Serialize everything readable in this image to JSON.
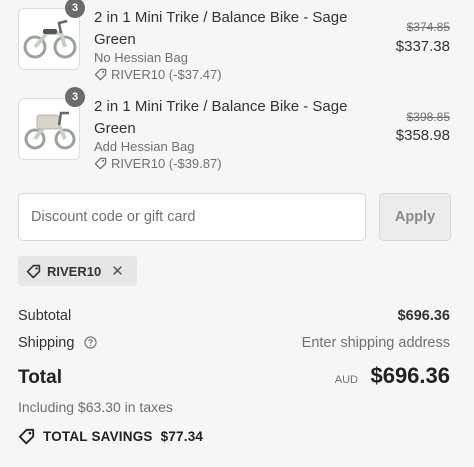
{
  "items": [
    {
      "quantity": "3",
      "name": "2 in 1 Mini Trike / Balance Bike - Sage Green",
      "variant": "No Hessian Bag",
      "discount": "RIVER10 (-$37.47)",
      "original_price": "$374.85",
      "price": "$337.38",
      "image_icon": "balance-bike-icon"
    },
    {
      "quantity": "3",
      "name": "2 in 1 Mini Trike / Balance Bike - Sage Green",
      "variant": "Add Hessian Bag",
      "discount": "RIVER10 (-$39.87)",
      "original_price": "$398.85",
      "price": "$358.98",
      "image_icon": "balance-bike-with-bag-icon"
    }
  ],
  "discount": {
    "placeholder": "Discount code or gift card",
    "apply_label": "Apply",
    "applied_code": "RIVER10"
  },
  "summary": {
    "subtotal_label": "Subtotal",
    "subtotal_value": "$696.36",
    "shipping_label": "Shipping",
    "shipping_value": "Enter shipping address",
    "total_label": "Total",
    "currency": "AUD",
    "total_value": "$696.36",
    "taxes_text": "Including $63.30 in taxes",
    "savings_label": "TOTAL SAVINGS",
    "savings_value": "$77.34"
  },
  "colors": {
    "background": "#f6f6f6",
    "badge": "#6b6b6b",
    "text": "#333333",
    "muted": "#707070"
  }
}
